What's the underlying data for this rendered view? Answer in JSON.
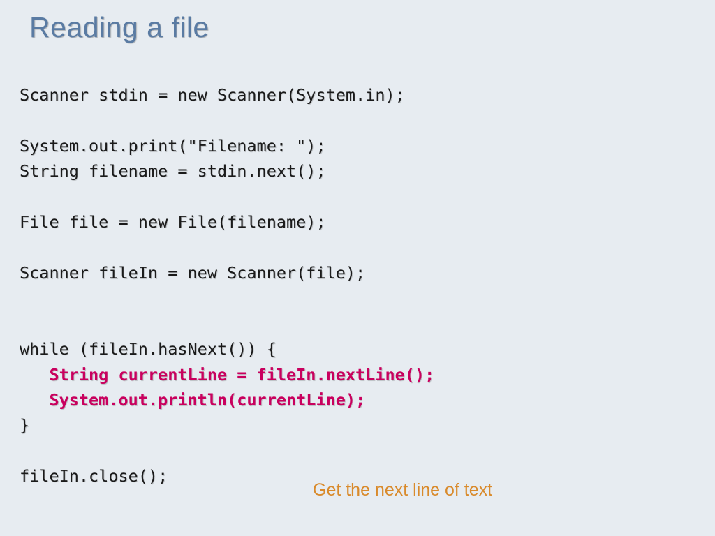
{
  "title": "Reading a file",
  "code": {
    "l1": "Scanner stdin = new Scanner(System.in);",
    "l2": "",
    "l3": "System.out.print(\"Filename: \");",
    "l4": "String filename = stdin.next();",
    "l5": "",
    "l6": "File file = new File(filename);",
    "l7": "",
    "l8": "Scanner fileIn = new Scanner(file);",
    "l9": "",
    "l10": "",
    "l11": "while (fileIn.hasNext()) {",
    "l12": "   String currentLine = fileIn.nextLine();",
    "l13": "   System.out.println(currentLine);",
    "l14": "}",
    "l15": "",
    "l16": "fileIn.close();"
  },
  "annotation": "Get the next line of text"
}
